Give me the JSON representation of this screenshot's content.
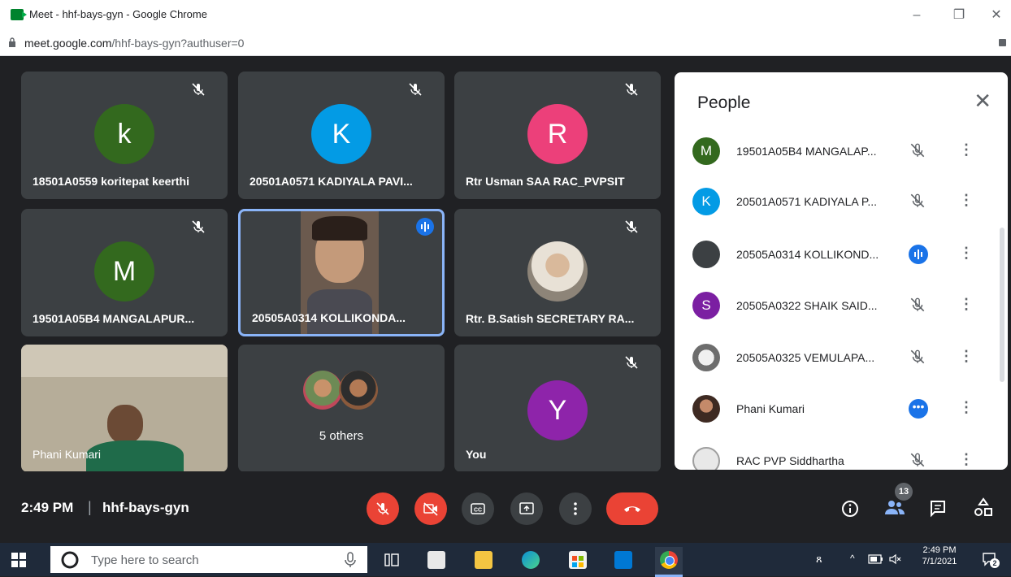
{
  "browser": {
    "title": "Meet - hhf-bays-gyn - Google Chrome",
    "url_host": "meet.google.com",
    "url_path": "/hhf-bays-gyn?authuser=0",
    "win_min": "–",
    "win_max": "❐",
    "win_close": "✕"
  },
  "tiles": [
    {
      "name": "18501A0559 koritepat keerthi",
      "initial": "k",
      "color": "#33691e"
    },
    {
      "name": "20501A0571 KADIYALA PAVI...",
      "initial": "K",
      "color": "#039be5"
    },
    {
      "name": "Rtr Usman SAA RAC_PVPSIT",
      "initial": "R",
      "color": "#ec407a"
    },
    {
      "name": "19501A05B4 MANGALAPUR...",
      "initial": "M",
      "color": "#33691e"
    },
    {
      "name": "20505A0314 KOLLIKONDA...",
      "initial": "",
      "color": ""
    },
    {
      "name": "Rtr. B.Satish SECRETARY RA...",
      "initial": "",
      "color": ""
    },
    {
      "name": "Phani Kumari",
      "initial": "",
      "color": ""
    },
    {
      "name": "5 others",
      "initial": "",
      "color": ""
    },
    {
      "name": "You",
      "initial": "Y",
      "color": "#8e24aa"
    }
  ],
  "people": {
    "title": "People",
    "close": "✕",
    "rows": [
      {
        "name": "19501A05B4 MANGALAP...",
        "initial": "M",
        "color": "#33691e",
        "state": "muted"
      },
      {
        "name": "20501A0571 KADIYALA P...",
        "initial": "K",
        "color": "#039be5",
        "state": "muted"
      },
      {
        "name": "20505A0314 KOLLIKOND...",
        "initial": "",
        "color": "#3c4043",
        "state": "speaking"
      },
      {
        "name": "20505A0322 SHAIK SAID...",
        "initial": "S",
        "color": "#7b1fa2",
        "state": "muted"
      },
      {
        "name": "20505A0325 VEMULAPA...",
        "initial": "",
        "color": "#9e9e9e",
        "state": "muted"
      },
      {
        "name": "Phani Kumari",
        "initial": "",
        "color": "#5d4037",
        "state": "active"
      },
      {
        "name": "RAC PVP Siddhartha",
        "initial": "",
        "color": "#bdbdbd",
        "state": "muted"
      }
    ],
    "more": "⋮"
  },
  "meeting": {
    "time": "2:49 PM",
    "separator": "|",
    "code": "hhf-bays-gyn",
    "participants_count": "13"
  },
  "taskbar": {
    "search_placeholder": "Type here to search",
    "clock_time": "2:49 PM",
    "clock_date": "7/1/2021",
    "notification_count": "2"
  },
  "colors": {
    "meet_bg": "#202124",
    "tile_bg": "#3c4043",
    "accent_blue": "#1a73e8",
    "end_call_red": "#ea4335",
    "taskbar_bg": "#1f2a3a"
  }
}
